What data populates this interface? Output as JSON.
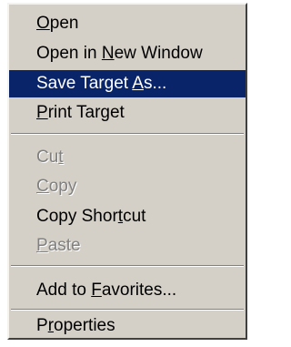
{
  "context_menu": {
    "items": [
      {
        "pre": "",
        "key": "O",
        "post": "pen",
        "state": "normal"
      },
      {
        "pre": "Open in ",
        "key": "N",
        "post": "ew Window",
        "state": "normal"
      },
      {
        "pre": "Save Target ",
        "key": "A",
        "post": "s...",
        "state": "highlighted"
      },
      {
        "pre": "",
        "key": "P",
        "post": "rint Target",
        "state": "normal"
      },
      {
        "pre": "Cu",
        "key": "t",
        "post": "",
        "state": "disabled"
      },
      {
        "pre": "",
        "key": "C",
        "post": "opy",
        "state": "disabled"
      },
      {
        "pre": "Copy Shor",
        "key": "t",
        "post": "cut",
        "state": "normal"
      },
      {
        "pre": "",
        "key": "P",
        "post": "aste",
        "state": "disabled"
      },
      {
        "pre": "Add to ",
        "key": "F",
        "post": "avorites...",
        "state": "normal"
      },
      {
        "pre": "P",
        "key": "r",
        "post": "operties",
        "state": "normal"
      }
    ]
  }
}
